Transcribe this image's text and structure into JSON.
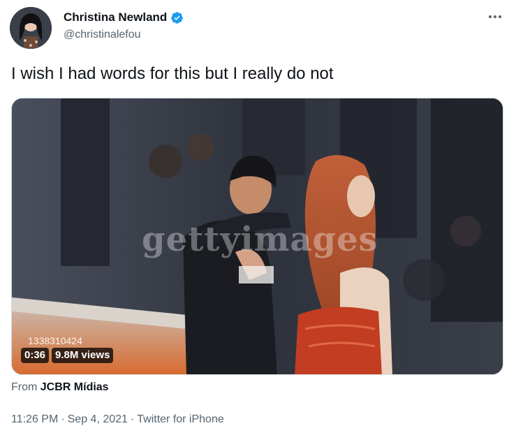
{
  "author": {
    "display_name": "Christina Newland",
    "handle": "@christinalefou",
    "verified": true
  },
  "tweet": {
    "text": "I wish I had words for this but I really do not"
  },
  "media": {
    "watermark": "gettyimages",
    "photo_id": "1338310424",
    "duration": "0:36",
    "views": "9.8M views"
  },
  "source": {
    "prefix": "From",
    "name": "JCBR Mídias"
  },
  "meta": {
    "time": "11:26 PM",
    "separator1": "·",
    "date": "Sep 4, 2021",
    "separator2": "·",
    "client": "Twitter for iPhone"
  },
  "colors": {
    "verified_blue": "#1d9bf0",
    "secondary_text": "#536471",
    "primary_text": "#0f1419"
  },
  "icons": {
    "more": "more-horizontal-icon",
    "verified": "verified-badge-icon"
  }
}
